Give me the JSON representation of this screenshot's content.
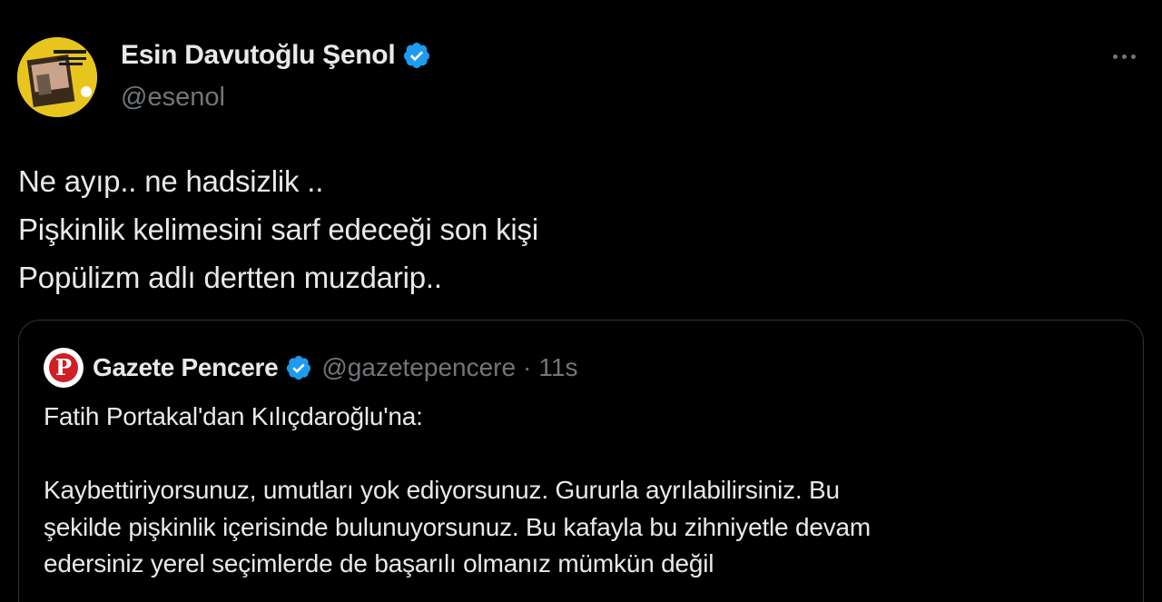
{
  "author": {
    "name": "Esin Davutoğlu Şenol",
    "handle": "@esenol",
    "verified_color": "#1d9bf0",
    "avatar_icon": "book-cover-avatar"
  },
  "more_icon": "more-horizontal-icon",
  "tweet": {
    "lines": [
      "Ne ayıp.. ne hadsizlik ..",
      "Pişkinlik kelimesini sarf edeceği son kişi",
      "Popülizm adlı dertten muzdarip.."
    ]
  },
  "quoted_tweet": {
    "author_name": "Gazete Pencere",
    "handle": "@gazetepencere",
    "separator": "·",
    "time": "11s",
    "avatar_letter": "P",
    "avatar_color": "#d11f26",
    "lines": [
      "Fatih Portakal'dan Kılıçdaroğlu'na:",
      "",
      "Kaybettiriyorsunuz, umutları yok ediyorsunuz. Gururla ayrılabilirsiniz. Bu",
      "şekilde pişkinlik içerisinde bulunuyorsunuz. Bu kafayla bu zihniyetle devam",
      "edersiniz yerel seçimlerde de başarılı olmanız mümkün değil"
    ]
  }
}
